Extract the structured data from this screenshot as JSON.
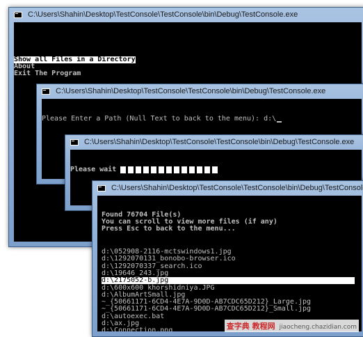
{
  "windows": [
    {
      "title": "C:\\Users\\Shahin\\Desktop\\TestConsole\\TestConsole\\bin\\Debug\\TestConsole.exe",
      "menu": [
        "Show all Files in a Directory",
        "About",
        "Exit The Program"
      ]
    },
    {
      "title": "C:\\Users\\Shahin\\Desktop\\TestConsole\\TestConsole\\bin\\Debug\\TestConsole.exe",
      "prompt": "Please Enter a Path (Null Text to back to the menu): d:\\"
    },
    {
      "title": "C:\\Users\\Shahin\\Desktop\\TestConsole\\TestConsole\\bin\\Debug\\TestConsole.exe",
      "wait_text": "Please wait",
      "progress_blocks": 13
    },
    {
      "title": "C:\\Users\\Shahin\\Desktop\\TestConsole\\TestConsole\\bin\\Debug\\TestConsole.exe",
      "header": [
        "Found 76704 File(s)",
        "You can scroll to view more files (if any)",
        "Press Esc to back to the menu..."
      ],
      "files": [
        "d:\\052908-2116-mctswindows1.jpg",
        "d:\\1292070131_bonobo-browser.ico",
        "d:\\1292070337_search.ico",
        "d:\\19646_243.jpg",
        "d:\\2175052-b.jpg",
        "d:\\600x600 khorshidniya.JPG",
        "d:\\AlbumArtSmall.jpg",
        "~_{50661171-6CD4-4E7A-9D0D-AB7CDC65D212}_Large.jpg",
        "~_{50661171-6CD4-4E7A-9D0D-AB7CDC65D212}_Small.jpg",
        "d:\\autoexec.bat",
        "d:\\ax.jpg",
        "d:\\Connection.png"
      ],
      "selected_index": 4
    }
  ],
  "watermark": {
    "main": "查字典 教程网",
    "sub": "jiaocheng.chazidian.com"
  }
}
